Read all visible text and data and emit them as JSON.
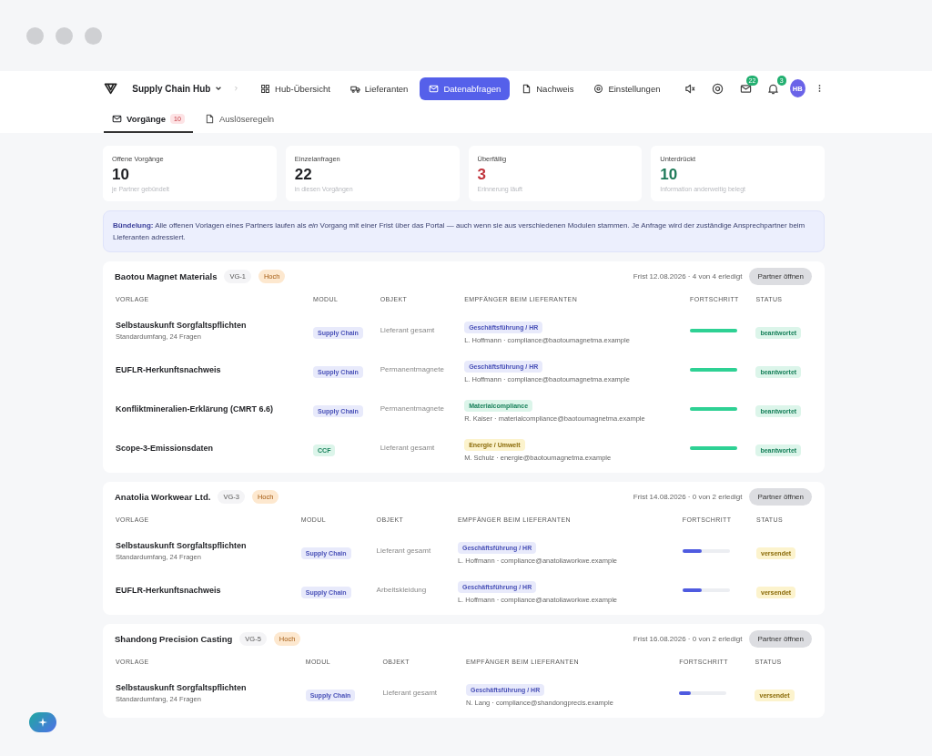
{
  "app": {
    "name": "Supply Chain Hub"
  },
  "nav": [
    {
      "label": "Hub-Übersicht",
      "selected": false
    },
    {
      "label": "Lieferanten",
      "selected": false
    },
    {
      "label": "Datenabfragen",
      "selected": true
    },
    {
      "label": "Nachweis",
      "selected": false
    },
    {
      "label": "Einstellungen",
      "selected": false
    }
  ],
  "toolbar": {
    "mail_count": "22",
    "bell_count": "3",
    "avatar": "HB"
  },
  "tabs": [
    {
      "label": "Vorgänge",
      "count": "10",
      "selected": true
    },
    {
      "label": "Auslöseregeln",
      "selected": false
    }
  ],
  "stats": [
    {
      "label": "Offene Vorgänge",
      "value": "10",
      "note": "je Partner gebündelt",
      "color": "#1f2024"
    },
    {
      "label": "Einzelanfragen",
      "value": "22",
      "note": "in diesen Vorgängen",
      "color": "#1f2024"
    },
    {
      "label": "Überfällig",
      "value": "3",
      "note": "Erinnerung läuft",
      "color": "#c0343c"
    },
    {
      "label": "Unterdrückt",
      "value": "10",
      "note": "Information anderweitig belegt",
      "color": "#1e7a58"
    }
  ],
  "info": "**Bündelung:** Alle offenen Vorlagen eines Partners laufen als *ein* Vorgang mit einer Frist über das Portal — auch wenn sie aus verschiedenen Modulen stammen. Je Anfrage wird der zuständige Ansprechpartner beim Lieferanten adressiert.",
  "groups": [
    {
      "partner": "Baotou Magnet Materials",
      "code": "VG-1",
      "priority": "Hoch",
      "summary": "Frist 12.08.2026 · 4 von 4 erledigt",
      "button": "Partner öffnen",
      "columns": [
        "VORLAGE",
        "MODUL",
        "OBJEKT",
        "EMPFÄNGER BEIM LIEFERANTEN",
        "FORTSCHRITT",
        "STATUS"
      ],
      "rows": [
        {
          "title": "Selbstauskunft Sorgfaltspflichten",
          "subtitle": "Standardumfang, 24 Fragen",
          "module": {
            "label": "Supply Chain",
            "color": "#e8eafb"
          },
          "object": "Lieferant gesamt",
          "recipient": {
            "role": "Geschäftsführung / HR",
            "color": "#e8eafb",
            "contact": "L. Hoffmann · compliance@baotoumagnetma.example"
          },
          "progress": {
            "level": 1,
            "color": "#2ed194"
          },
          "status": {
            "label": "beantwortet",
            "color": "#dcf5ea"
          }
        },
        {
          "title": "EUFLR-Herkunftsnachweis",
          "module": {
            "label": "Supply Chain",
            "color": "#e8eafb"
          },
          "object": "Permanentmagnete",
          "recipient": {
            "role": "Geschäftsführung / HR",
            "color": "#e8eafb",
            "contact": "L. Hoffmann · compliance@baotoumagnetma.example"
          },
          "progress": {
            "level": 1,
            "color": "#2ed194"
          },
          "status": {
            "label": "beantwortet",
            "color": "#dcf5ea"
          }
        },
        {
          "title": "Konfliktmineralien-Erklärung (CMRT 6.6)",
          "module": {
            "label": "Supply Chain",
            "color": "#e8eafb"
          },
          "object": "Permanentmagnete",
          "recipient": {
            "role": "Materialcompliance",
            "color": "#dcf5ea",
            "contact": "R. Kaiser · materialcompliance@baotoumagnetma.example"
          },
          "progress": {
            "level": 1,
            "color": "#2ed194"
          },
          "status": {
            "label": "beantwortet",
            "color": "#dcf5ea"
          }
        },
        {
          "title": "Scope-3-Emissionsdaten",
          "module": {
            "label": "CCF",
            "color": "#dcf5ea"
          },
          "object": "Lieferant gesamt",
          "recipient": {
            "role": "Energie / Umwelt",
            "color": "#fcf3cd",
            "contact": "M. Schulz · energie@baotoumagnetma.example"
          },
          "progress": {
            "level": 1,
            "color": "#2ed194"
          },
          "status": {
            "label": "beantwortet",
            "color": "#dcf5ea"
          }
        }
      ]
    },
    {
      "partner": "Anatolia Workwear Ltd.",
      "code": "VG-3",
      "priority": "Hoch",
      "summary": "Frist 14.08.2026 · 0 von 2 erledigt",
      "button": "Partner öffnen",
      "columns": [
        "VORLAGE",
        "MODUL",
        "OBJEKT",
        "EMPFÄNGER BEIM LIEFERANTEN",
        "FORTSCHRITT",
        "STATUS"
      ],
      "rows": [
        {
          "title": "Selbstauskunft Sorgfaltspflichten",
          "subtitle": "Standardumfang, 24 Fragen",
          "module": {
            "label": "Supply Chain",
            "color": "#e8eafb"
          },
          "object": "Lieferant gesamt",
          "recipient": {
            "role": "Geschäftsführung / HR",
            "color": "#e8eafb",
            "contact": "L. Hoffmann · compliance@anatoliaworkwe.example"
          },
          "progress": {
            "level": 0.4,
            "color": "#4f5be0"
          },
          "status": {
            "label": "versendet",
            "color": "#fcf3cd"
          }
        },
        {
          "title": "EUFLR-Herkunftsnachweis",
          "module": {
            "label": "Supply Chain",
            "color": "#e8eafb"
          },
          "object": "Arbeitskleidung",
          "recipient": {
            "role": "Geschäftsführung / HR",
            "color": "#e8eafb",
            "contact": "L. Hoffmann · compliance@anatoliaworkwe.example"
          },
          "progress": {
            "level": 0.4,
            "color": "#4f5be0"
          },
          "status": {
            "label": "versendet",
            "color": "#fcf3cd"
          }
        }
      ]
    },
    {
      "partner": "Shandong Precision Casting",
      "code": "VG-5",
      "priority": "Hoch",
      "summary": "Frist 16.08.2026 · 0 von 2 erledigt",
      "button": "Partner öffnen",
      "columns": [
        "VORLAGE",
        "MODUL",
        "OBJEKT",
        "EMPFÄNGER BEIM LIEFERANTEN",
        "FORTSCHRITT",
        "STATUS"
      ],
      "rows": [
        {
          "title": "Selbstauskunft Sorgfaltspflichten",
          "subtitle": "Standardumfang, 24 Fragen",
          "module": {
            "label": "Supply Chain",
            "color": "#e8eafb"
          },
          "object": "Lieferant gesamt",
          "recipient": {
            "role": "Geschäftsführung / HR",
            "color": "#e8eafb",
            "contact": "N. Lang · compliance@shandongprecis.example"
          },
          "progress": {
            "level": 0.25,
            "color": "#4f5be0"
          },
          "status": {
            "label": "versendet",
            "color": "#fcf3cd"
          }
        }
      ]
    }
  ]
}
